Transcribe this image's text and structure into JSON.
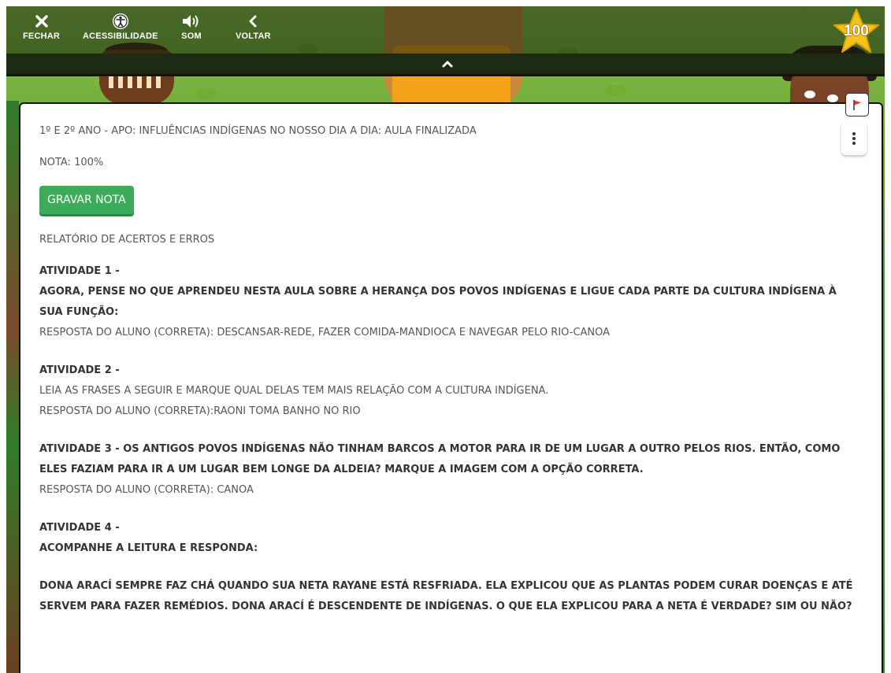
{
  "toolbar": {
    "close_label": "FECHAR",
    "accessibility_label": "ACESSIBILIDADE",
    "sound_label": "SOM",
    "back_label": "VOLTAR"
  },
  "score": {
    "value": "100"
  },
  "report": {
    "title": "1º E 2º ANO - APO: INFLUÊNCIAS INDÍGENAS NO NOSSO DIA A DIA: AULA FINALIZADA",
    "grade": "NOTA: 100%",
    "save_button": "GRAVAR NOTA",
    "section_title": "RELATÓRIO DE ACERTOS E ERROS",
    "activities": [
      {
        "heading": "ATIVIDADE 1 -",
        "question": "AGORA, PENSE NO QUE APRENDEU NESTA AULA SOBRE A HERANÇA DOS POVOS INDÍGENAS E LIGUE CADA PARTE DA CULTURA INDÍGENA À SUA FUNÇÃO:",
        "answer": "RESPOSTA DO ALUNO (CORRETA): DESCANSAR-REDE, FAZER COMIDA-MANDIOCA E NAVEGAR PELO RIO-CANOA"
      },
      {
        "heading": "ATIVIDADE 2 -",
        "question": "LEIA AS FRASES A SEGUIR E MARQUE QUAL DELAS TEM MAIS RELAÇÃO COM A CULTURA INDÍGENA.",
        "answer": "RESPOSTA DO ALUNO (CORRETA):RAONI TOMA BANHO NO RIO"
      },
      {
        "heading": "ATIVIDADE 3 - OS ANTIGOS POVOS INDÍGENAS NÃO TINHAM BARCOS A MOTOR PARA IR DE UM LUGAR A OUTRO PELOS RIOS. ENTÃO, COMO ELES FAZIAM PARA IR A UM LUGAR BEM LONGE DA ALDEIA? MARQUE A IMAGEM COM A OPÇÃO CORRETA.",
        "answer": "RESPOSTA DO ALUNO (CORRETA): CANOA"
      },
      {
        "heading": "ATIVIDADE 4 -",
        "question": "ACOMPANHE A LEITURA E RESPONDA:",
        "text": "DONA ARACÍ SEMPRE FAZ CHÁ QUANDO SUA NETA RAYANE ESTÁ RESFRIADA. ELA EXPLICOU QUE AS PLANTAS PODEM CURAR DOENÇAS E ATÉ SERVEM PARA FAZER REMÉDIOS. DONA ARACÍ É DESCENDENTE DE INDÍGENAS. O QUE ELA EXPLICOU PARA A NETA É VERDADE? SIM OU NÃO?"
      }
    ]
  },
  "colors": {
    "button_green": "#3cab5a",
    "star_yellow": "#f7c21b",
    "flag_red": "#e53935"
  },
  "icons": [
    "close-icon",
    "accessibility-icon",
    "sound-icon",
    "back-chevron-icon",
    "chevron-up-icon",
    "star-icon",
    "flag-icon",
    "more-vertical-icon"
  ]
}
